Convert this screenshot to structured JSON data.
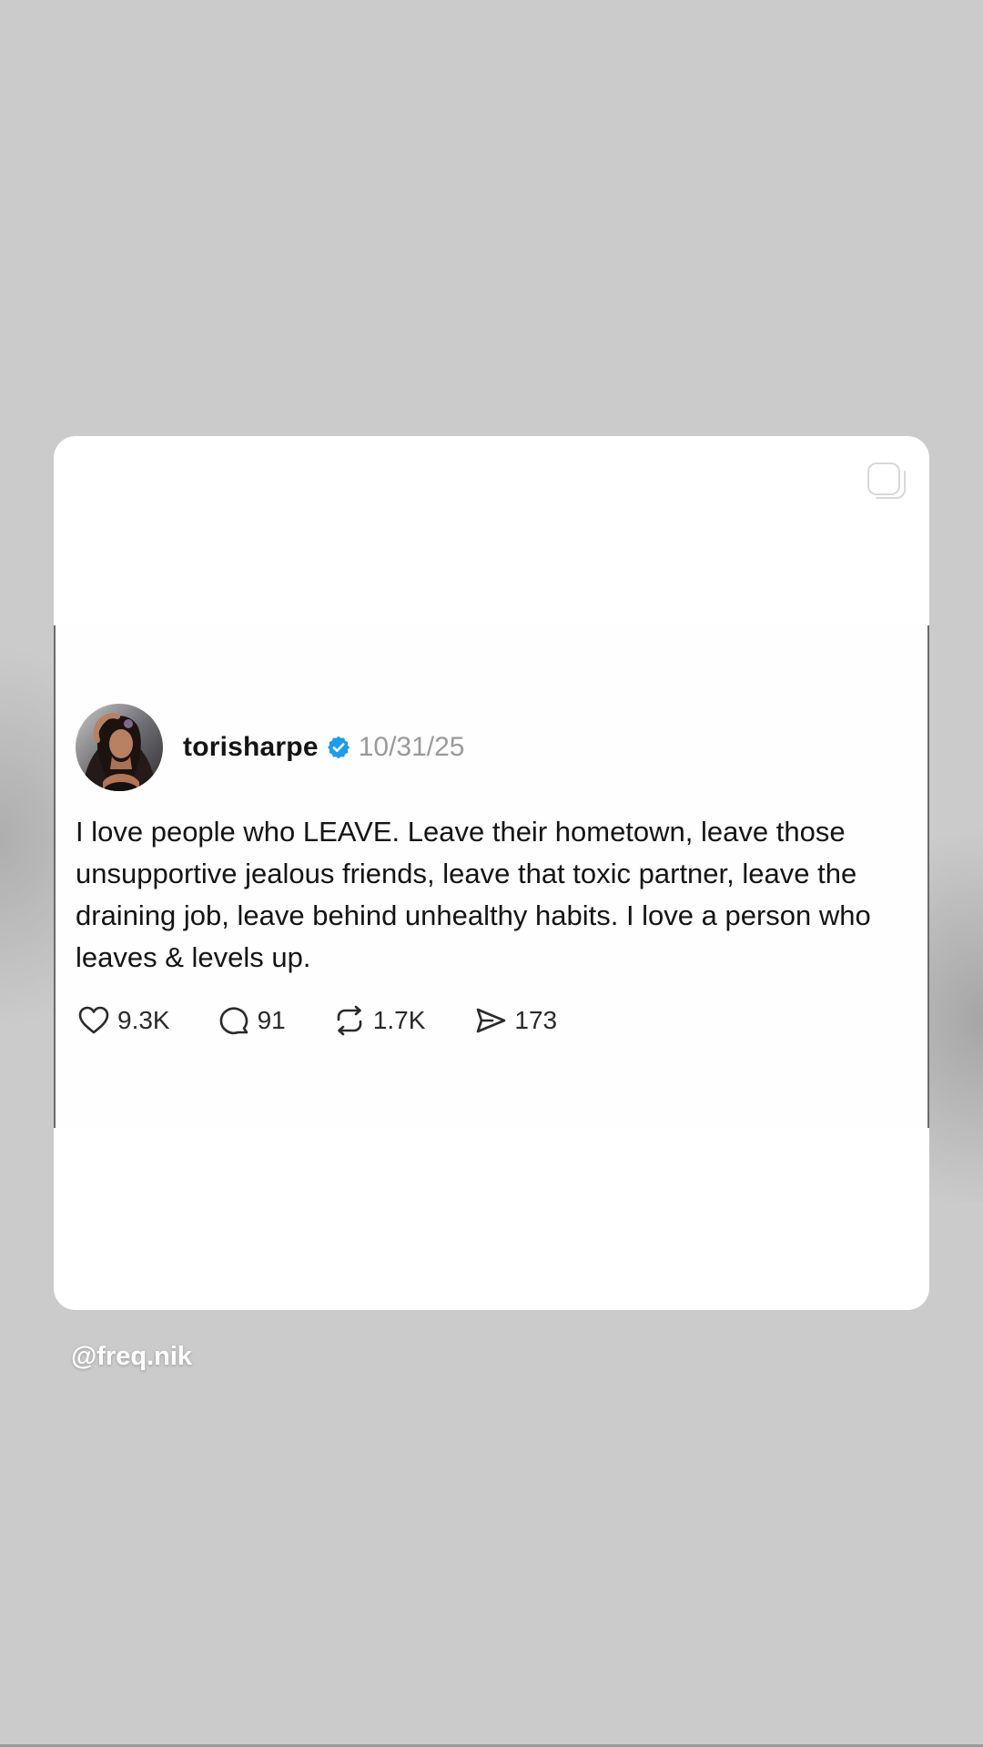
{
  "post": {
    "username": "torisharpe",
    "date": "10/31/25",
    "text": "I love people who LEAVE. Leave their hometown, leave those unsupportive jealous friends, leave that toxic partner, leave the draining job, leave behind unhealthy habits. I love a person who leaves & levels up.",
    "verified": true,
    "stats": {
      "likes": "9.3K",
      "replies": "91",
      "reposts": "1.7K",
      "shares": "173"
    }
  },
  "sticker": {
    "mention": "@freq.nik"
  },
  "colors": {
    "background": "#cbcbcb",
    "card": "#ffffff",
    "verified_blue": "#1d9bf0",
    "date_gray": "#9a9a9a",
    "text": "#141414"
  },
  "icons": [
    "copy-icon",
    "heart-icon",
    "comment-icon",
    "repost-icon",
    "share-icon",
    "verified-badge-icon"
  ]
}
